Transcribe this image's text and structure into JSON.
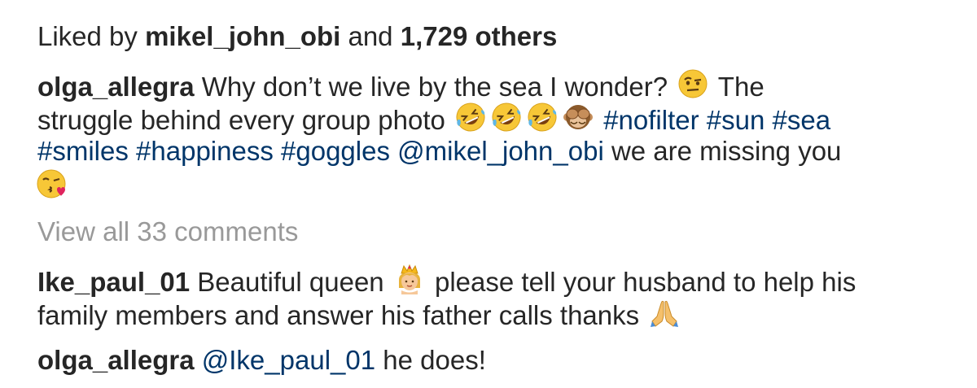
{
  "likes": {
    "prefix": "Liked by ",
    "user": "mikel_john_obi",
    "middle": " and ",
    "count": "1,729 others"
  },
  "caption": {
    "username": "olga_allegra",
    "text_1": " Why don’t we live by the sea I wonder?",
    "text_2": " The",
    "text_3": "struggle behind every group photo",
    "hashtags_line2": [
      "#nofilter",
      "#sun",
      "#sea"
    ],
    "hashtags_line3": [
      "#smiles",
      "#happiness",
      "#goggles"
    ],
    "mention": "@mikel_john_obi",
    "text_4": " we are missing you",
    "emojis": [
      "raised-eyebrow-face",
      "rofl-face",
      "rofl-face",
      "rofl-face",
      "see-no-evil-monkey",
      "kissing-heart-face"
    ]
  },
  "view_all_comments": "View all 33 comments",
  "comments": [
    {
      "username": "Ike_paul_01",
      "text_1": " Beautiful queen",
      "emoji_1": "princess-crown",
      "text_2": " please tell your husband to help his",
      "text_3": "family members and answer his father calls thanks",
      "emoji_2": "folded-hands"
    },
    {
      "username": "olga_allegra",
      "mention": "@Ike_paul_01",
      "text": " he does!"
    }
  ],
  "colors": {
    "text": "#262626",
    "link": "#003569",
    "muted": "#999999"
  }
}
